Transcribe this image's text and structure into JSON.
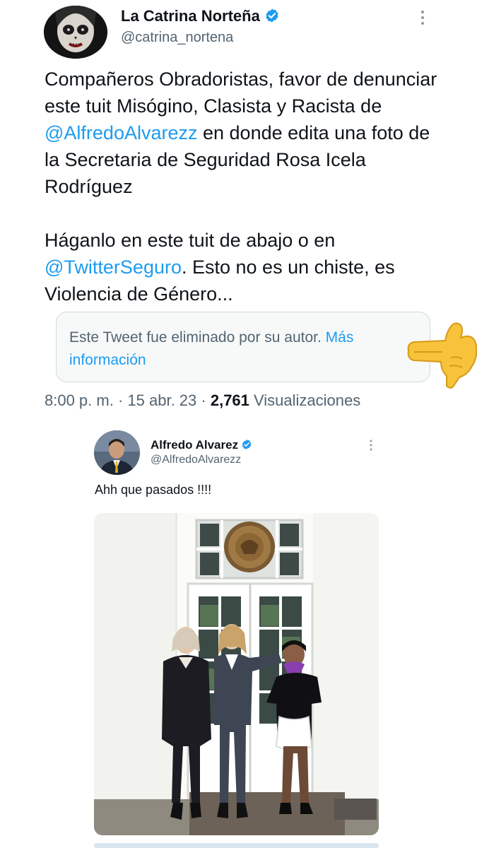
{
  "main_tweet": {
    "author": {
      "display_name": "La Catrina Norteña",
      "handle": "@catrina_nortena",
      "verified": true
    },
    "body": {
      "p1_a": "Compañeros Obradoristas, favor de denunciar este tuit Misógino, Clasista y Racista de ",
      "p1_mention": "@AlfredoAlvarezz",
      "p1_b": " en donde edita una foto de la Secretaria de Seguridad Rosa Icela Rodríguez",
      "p2_a": "Háganlo en este tuit de abajo o en ",
      "p2_mention": "@TwitterSeguro",
      "p2_b": ". Esto no es un chiste, es Violencia de Género..."
    },
    "deleted_notice": {
      "text": "Este Tweet fue eliminado por su autor. ",
      "link": "Más información"
    },
    "meta": {
      "time": "8:00 p. m.",
      "sep1": " · ",
      "date": "15 abr. 23",
      "sep2": " · ",
      "views_count": "2,761",
      "views_label": " Visualizaciones"
    },
    "icons": {
      "verified": "verified-badge-icon",
      "more": "more-vertical-icon",
      "pointer": "backhand-index-pointing-left-emoji"
    }
  },
  "embedded_tweet": {
    "author": {
      "display_name": "Alfredo Alvarez",
      "handle": "@AlfredoAlvarezz",
      "verified": true
    },
    "text": "Ahh que pasados !!!!"
  },
  "colors": {
    "link": "#1d9bf0",
    "secondary_text": "#536471",
    "primary_text": "#0f1419",
    "border": "#cfd9de"
  }
}
